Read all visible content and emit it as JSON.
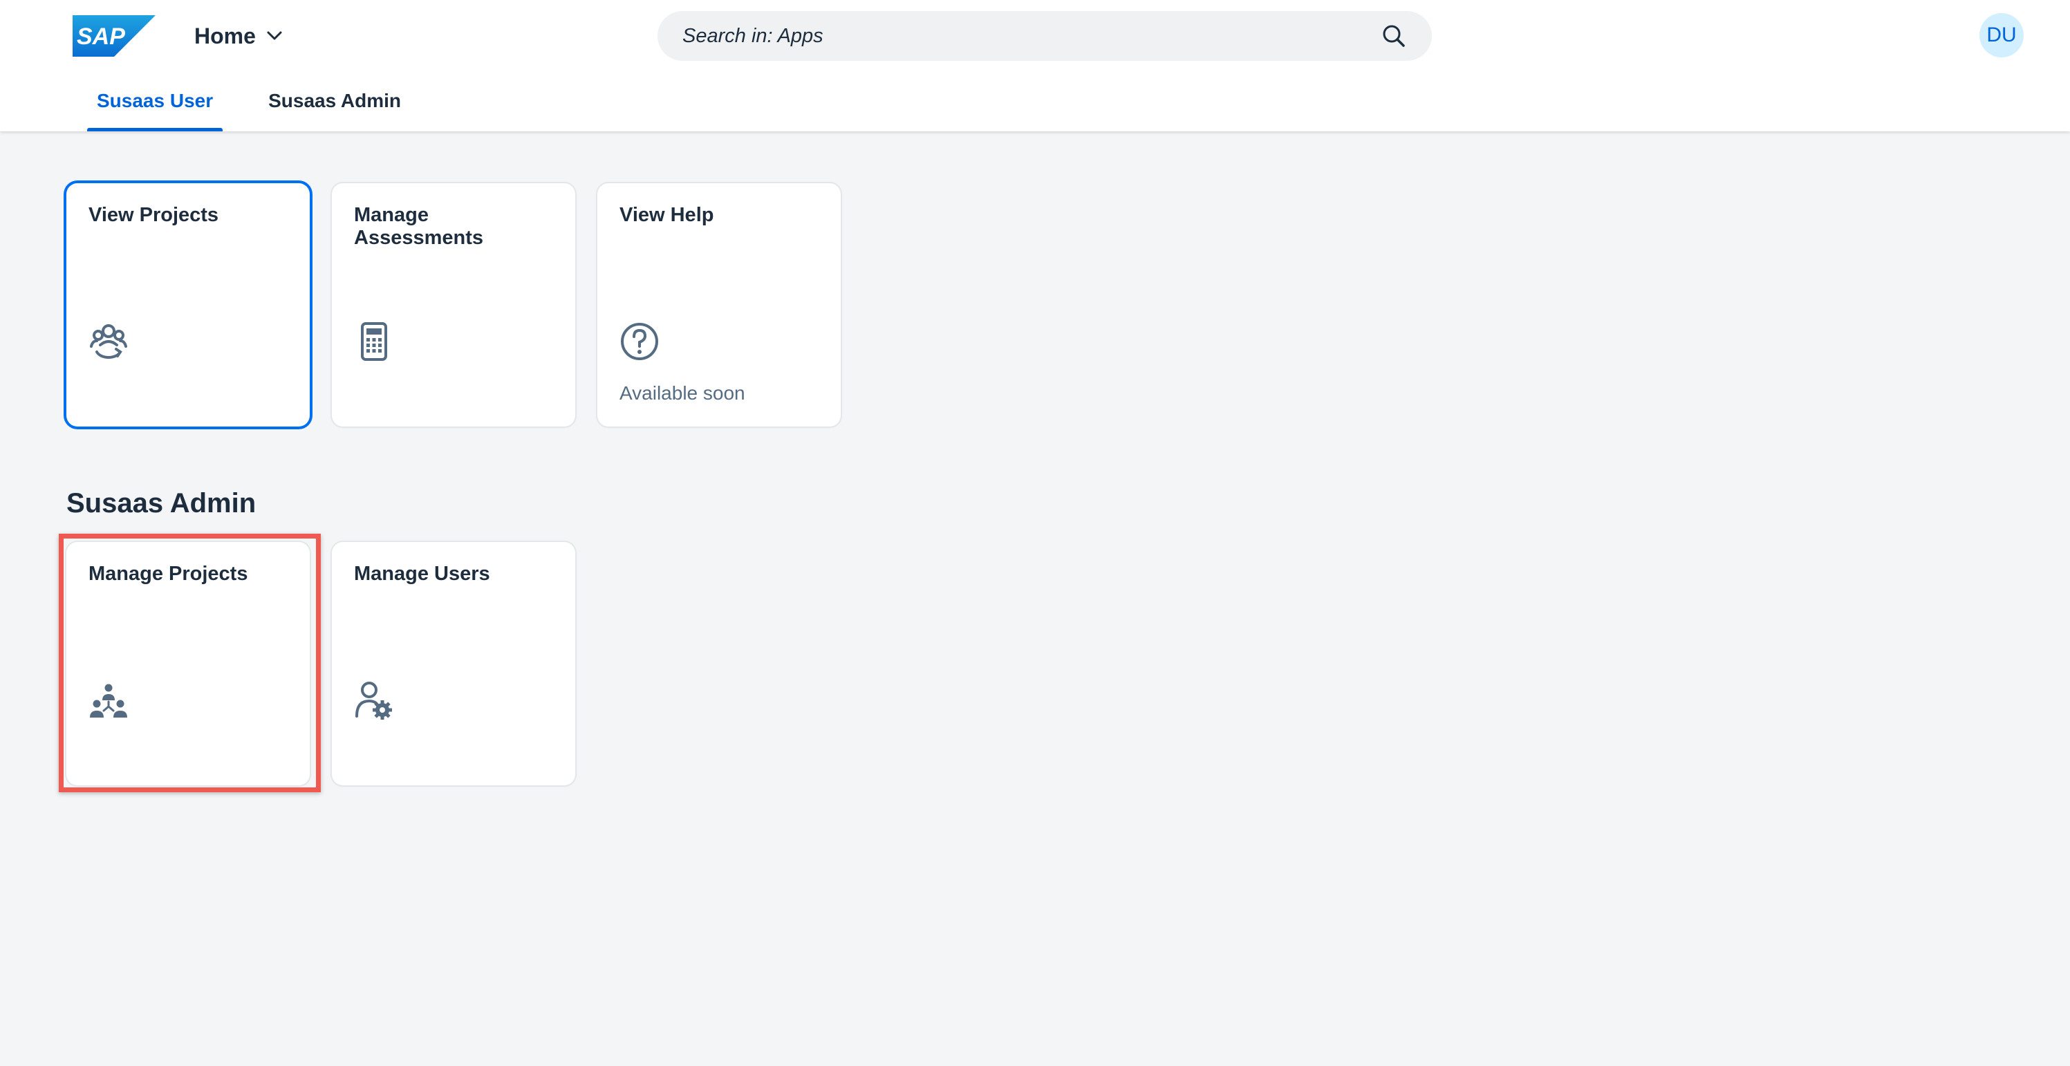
{
  "header": {
    "logo_text": "SAP",
    "home_label": "Home",
    "search_placeholder": "Search in: Apps",
    "avatar_initials": "DU",
    "tabs": [
      {
        "label": "Susaas User",
        "active": true
      },
      {
        "label": "Susaas Admin",
        "active": false
      }
    ]
  },
  "sections": {
    "user": {
      "tiles": [
        {
          "title": "View Projects",
          "icon": "group-refresh-icon",
          "footer": ""
        },
        {
          "title": "Manage Assessments",
          "icon": "calculator-icon",
          "footer": ""
        },
        {
          "title": "View Help",
          "icon": "question-icon",
          "footer": "Available soon"
        }
      ]
    },
    "admin": {
      "title": "Susaas Admin",
      "tiles": [
        {
          "title": "Manage Projects",
          "icon": "org-people-icon",
          "footer": ""
        },
        {
          "title": "Manage Users",
          "icon": "user-settings-icon",
          "footer": ""
        }
      ]
    }
  },
  "colors": {
    "accent": "#0064d9",
    "highlight": "#f0594f",
    "background": "#f4f5f7",
    "icon": "#556b82"
  }
}
